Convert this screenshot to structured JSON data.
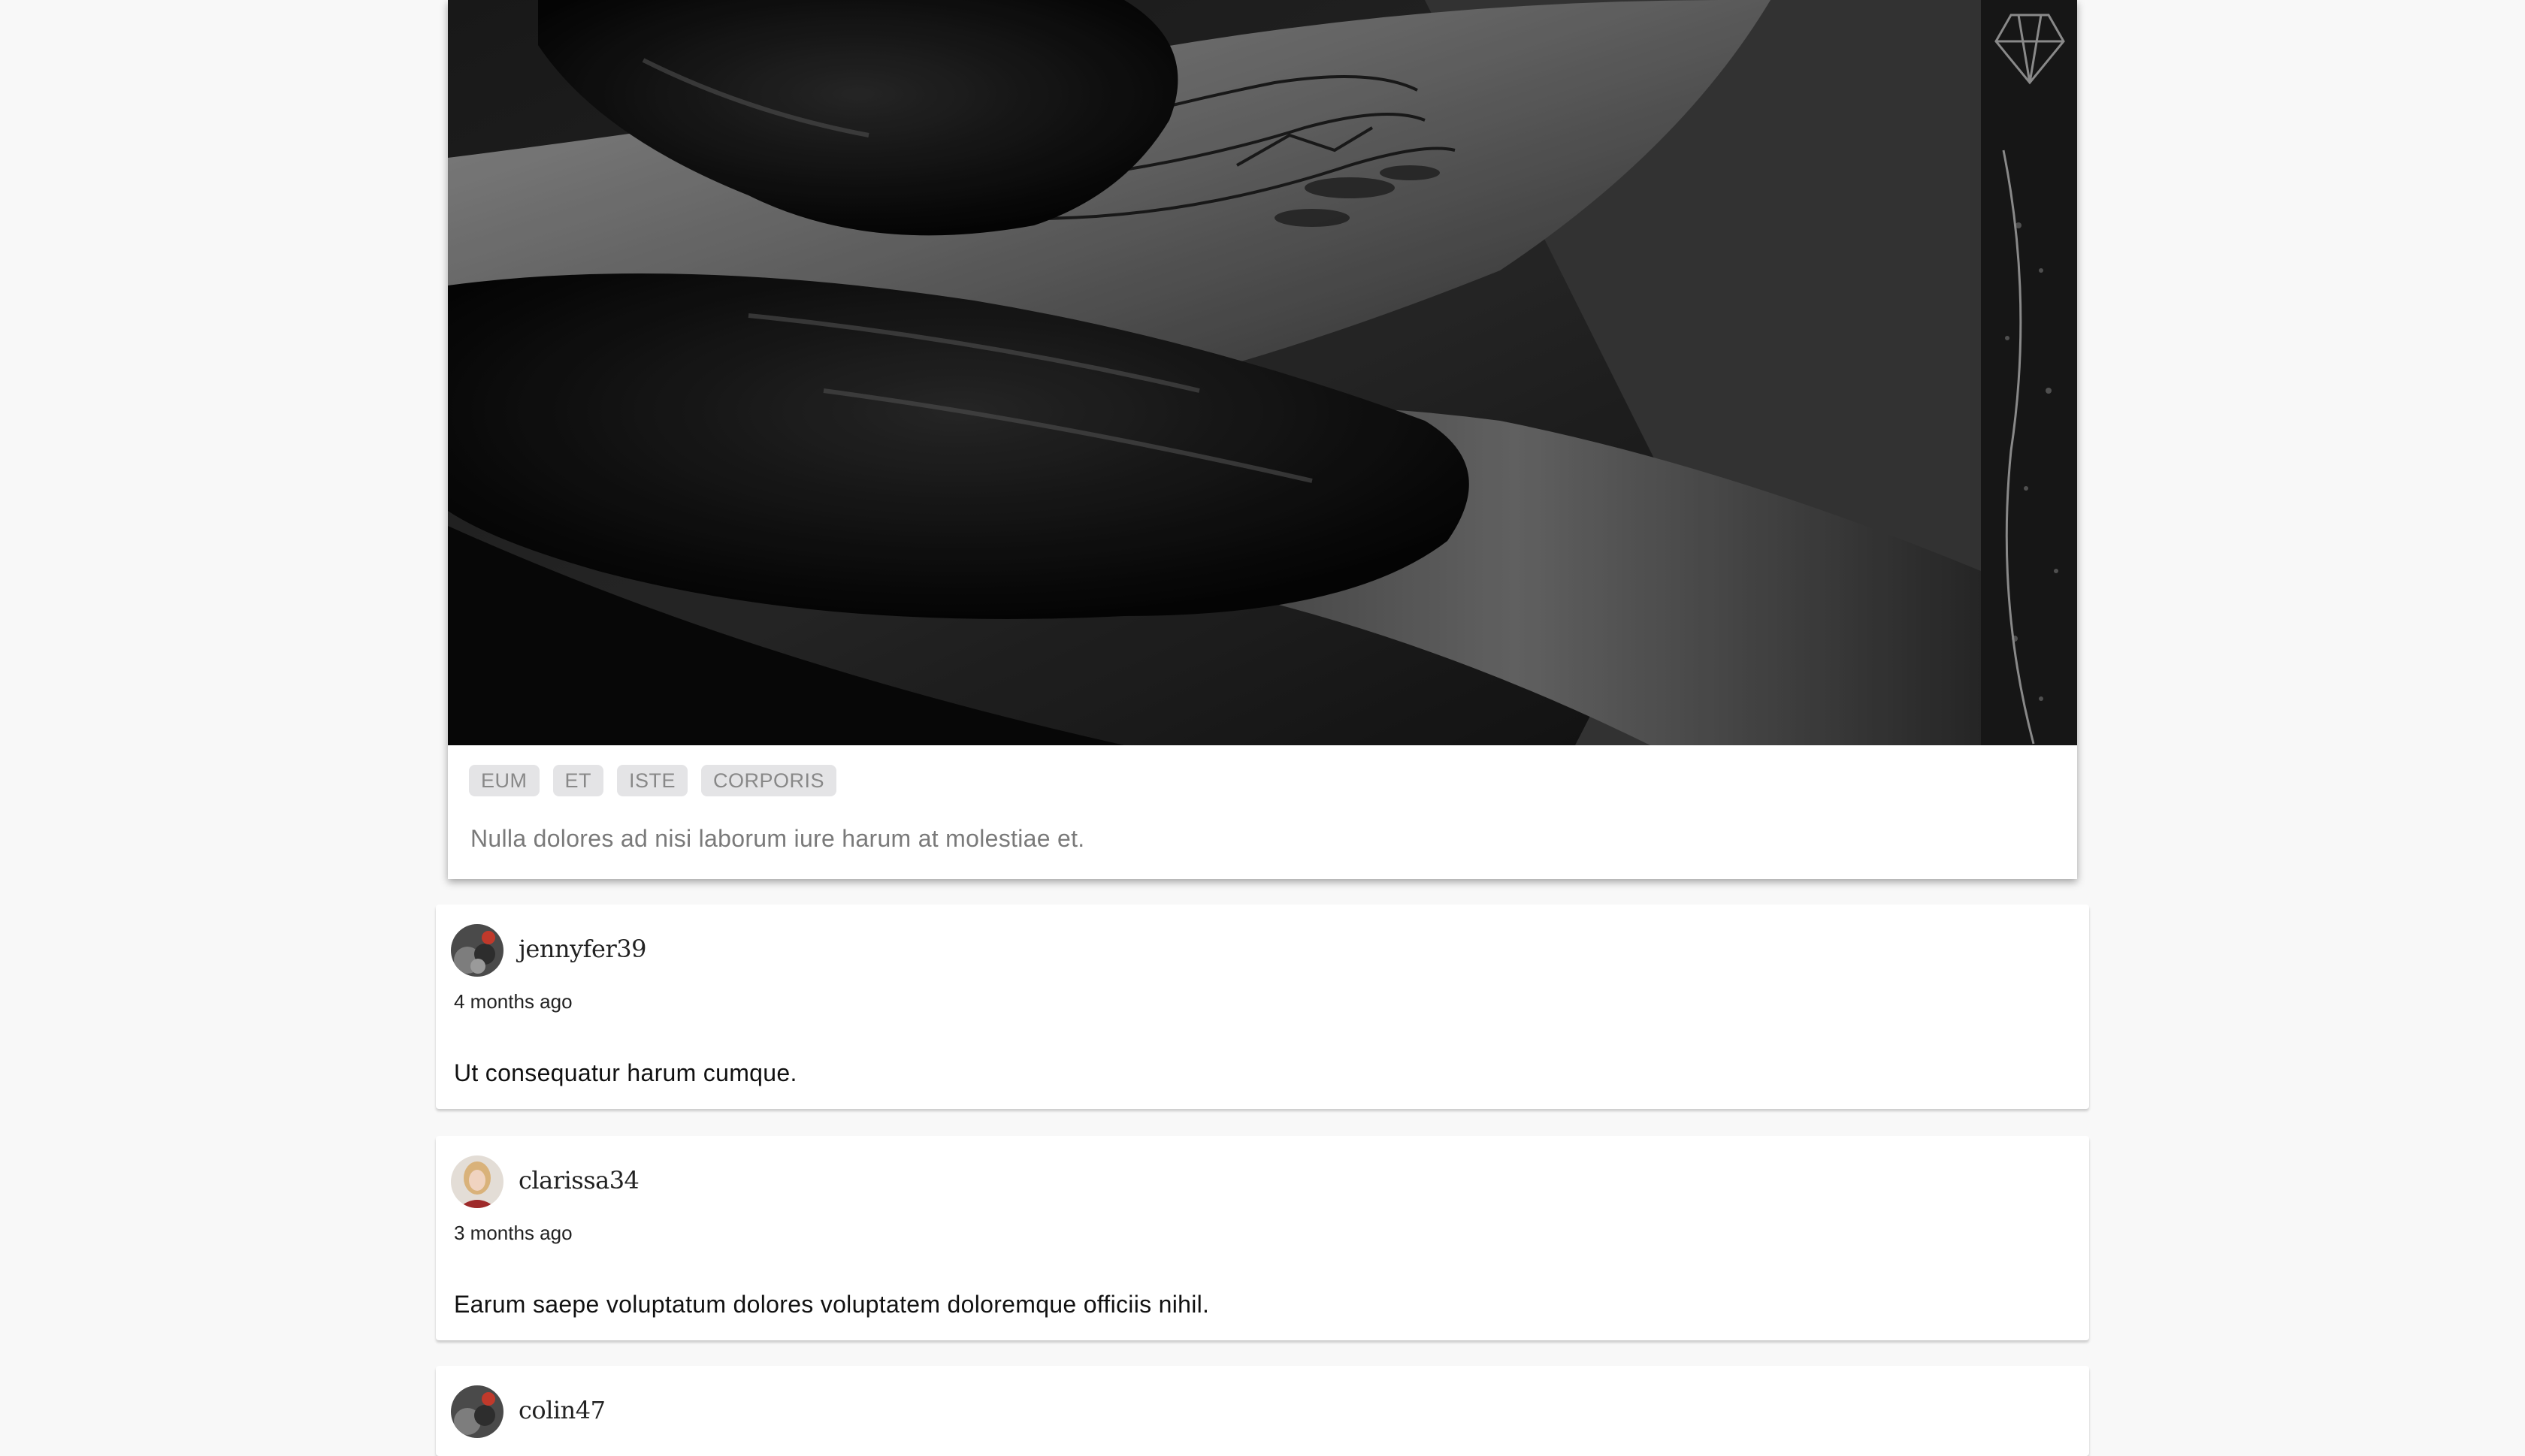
{
  "post": {
    "image_subject": "tattoo-session-photo",
    "tags": [
      "EUM",
      "ET",
      "ISTE",
      "CORPORIS"
    ],
    "description": "Nulla dolores ad nisi laborum iure harum at molestiae et."
  },
  "comments": [
    {
      "username": "jennyfer39",
      "time": "4 months ago",
      "text": "Ut consequatur harum cumque."
    },
    {
      "username": "clarissa34",
      "time": "3 months ago",
      "text": "Earum saepe voluptatum dolores voluptatem doloremque officiis nihil."
    },
    {
      "username": "colin47",
      "time": "",
      "text": ""
    }
  ],
  "colors": {
    "page_bg": "#f8f8f8",
    "card_bg": "#ffffff",
    "tag_bg": "#e4e4e6",
    "tag_text": "#888888",
    "description_text": "#7a7a7a"
  }
}
